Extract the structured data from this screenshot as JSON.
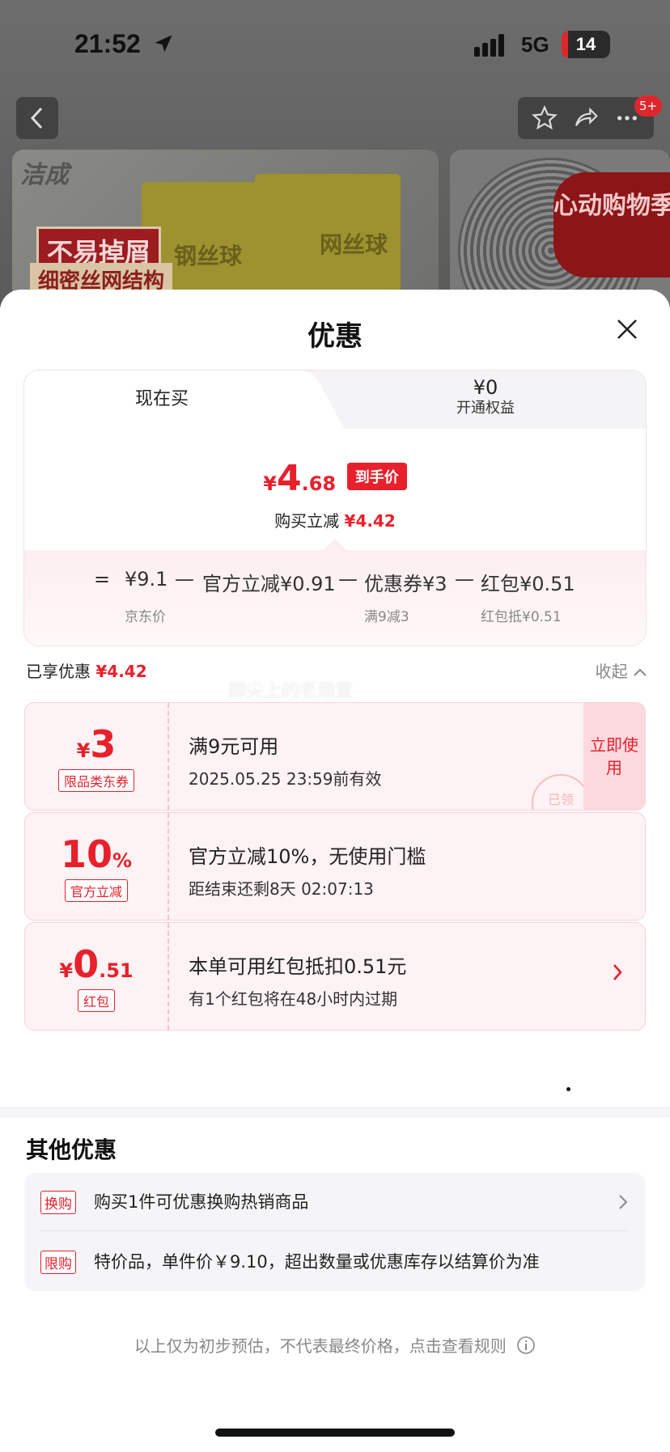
{
  "status_bar": {
    "time": "21:52",
    "network": "5G",
    "battery": "14",
    "battery_level": 0.14
  },
  "header": {
    "badge": "5+"
  },
  "product": {
    "brand": "洁成",
    "promo_tag": "不易掉屑",
    "promo_sub": "细密丝网结构",
    "pack_label_1": "钢丝球",
    "pack_label_2": "网丝球",
    "festival": "心动购物季"
  },
  "sheet": {
    "title": "优惠"
  },
  "tabs": {
    "active_label": "现在买",
    "inactive_price": "¥0",
    "inactive_label": "开通权益"
  },
  "price": {
    "yen": "¥",
    "int": "4",
    "dec": ".68",
    "tag": "到手价",
    "save_label": "购买立减",
    "save_value": "¥4.42"
  },
  "formula": {
    "eq": "=",
    "base": "¥9.1",
    "base_sub": "京东价",
    "minus1": "—",
    "official": "官方立减¥0.91",
    "minus2": "—",
    "coupon": "优惠券¥3",
    "coupon_sub": "满9减3",
    "minus3": "—",
    "redpacket": "红包¥0.51",
    "redpacket_sub": "红包抵¥0.51"
  },
  "enjoyed": {
    "label": "已享优惠",
    "value": "¥4.42",
    "collapse": "收起"
  },
  "watermark": "脚尖上的老顽童",
  "coupons": [
    {
      "yen": "¥",
      "value": "3",
      "tag": "限品类东券",
      "title": "满9元可用",
      "desc": "2025.05.25 23:59前有效",
      "action": "立即使用",
      "stamp": "已领"
    },
    {
      "value": "10",
      "unit": "%",
      "tag": "官方立减",
      "title": "官方立减10%，无使用门槛",
      "desc": "距结束还剩8天 02:07:13"
    },
    {
      "yen": "¥",
      "value": "0",
      "dec": ".51",
      "tag": "红包",
      "title": "本单可用红包抵扣0.51元",
      "desc": "有1个红包将在48小时内过期"
    }
  ],
  "other": {
    "title": "其他优惠",
    "items": [
      {
        "tag": "换购",
        "text": "购买1件可优惠换购热销商品"
      },
      {
        "tag": "限购",
        "text": "特价品，单件价￥9.10，超出数量或优惠库存以结算价为准"
      }
    ]
  },
  "footer": {
    "note": "以上仅为初步预估，不代表最终价格，点击查看规则"
  },
  "colors": {
    "accent": "#e8202c",
    "coupon_bg": "#fdf2f4"
  }
}
